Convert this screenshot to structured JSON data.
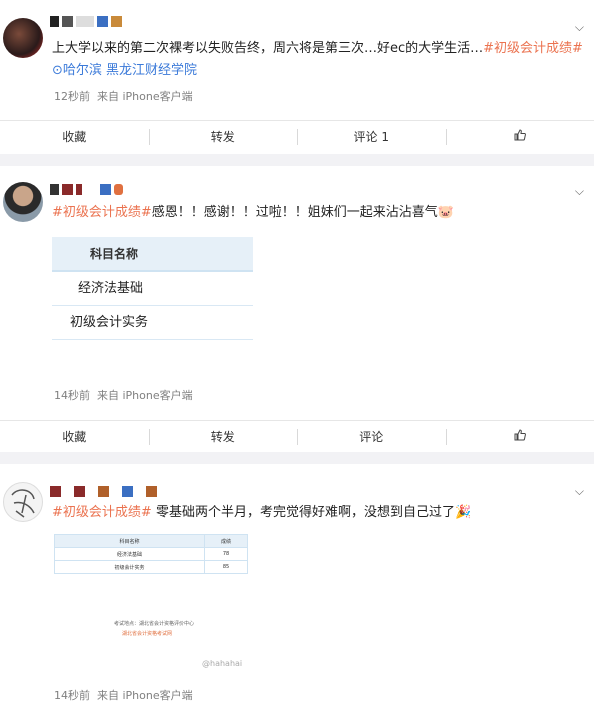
{
  "posts": [
    {
      "text": "上大学以来的第二次裸考以失败告终，周六将是第三次…好ec的大学生活…",
      "tag": "#初级会计成绩#",
      "location": "哈尔滨 黑龙江财经学院",
      "time": "12秒前",
      "source": "来自 iPhone客户端",
      "actions": {
        "collect": "收藏",
        "forward": "转发",
        "comment": "评论 1",
        "like": ""
      },
      "name_colors": [
        "#2a2a2a",
        "#555555",
        "#e0e0e0",
        "#3b6fc2",
        "#c98a3a"
      ]
    },
    {
      "tag": "#初级会计成绩#",
      "text": "感恩！！感谢！！过啦！！姐妹们一起来沾沾喜气",
      "emoji": "🐷",
      "image": {
        "header": "科目名称",
        "rows": [
          "经济法基础",
          "初级会计实务"
        ]
      },
      "time": "14秒前",
      "source": "来自 iPhone客户端",
      "actions": {
        "collect": "收藏",
        "forward": "转发",
        "comment": "评论",
        "like": ""
      },
      "name_colors": [
        "#333333",
        "#8a2a2a",
        "#8a2a2a",
        "#ffffff",
        "#3b6fc2",
        "#e07040"
      ]
    },
    {
      "tag": "#初级会计成绩#",
      "text": "零基础两个半月，考完觉得好难啊，没想到自己过了",
      "emoji": "🎉",
      "image": {
        "headers": [
          "科目名称",
          "成绩"
        ],
        "rows": [
          [
            "经济法基础",
            "78"
          ],
          [
            "初级会计实务",
            "85"
          ]
        ],
        "note1": "考试地点：湖北省会计资格评价中心",
        "note2": "湖北省会计资格考试网",
        "watermark": "@hahahai"
      },
      "time": "14秒前",
      "source": "来自 iPhone客户端",
      "name_colors": [
        "#8a2a2a",
        "#8a2a2a",
        "#b0602a",
        "#3b6fc2",
        "#b0602a"
      ]
    }
  ],
  "colors": {
    "tag": "#eb7350",
    "link": "#3b7ad9",
    "separator": "#f2f2f5"
  }
}
